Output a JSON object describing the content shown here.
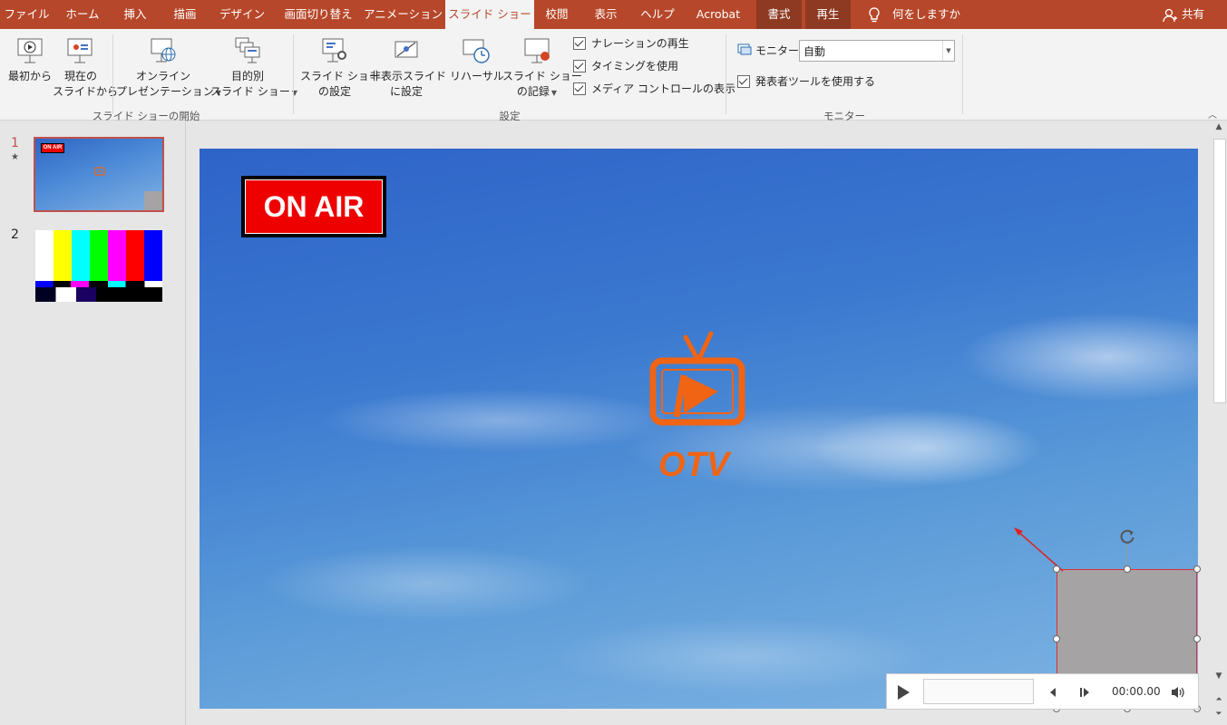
{
  "tabs": [
    "ファイル",
    "ホーム",
    "挿入",
    "描画",
    "デザイン",
    "画面切り替え",
    "アニメーション",
    "スライド ショー",
    "校閲",
    "表示",
    "ヘルプ",
    "Acrobat",
    "書式",
    "再生"
  ],
  "active_tab": "スライド ショー",
  "tell_me": "何をしますか",
  "share": "共有",
  "ribbon": {
    "start_group": "スライド ショーの開始",
    "from_beginning": "最初から",
    "from_current_1": "現在の",
    "from_current_2": "スライドから",
    "online_1": "オンライン",
    "online_2": "プレゼンテーション",
    "custom_1": "目的別",
    "custom_2": "スライド ショー",
    "setup_group": "設定",
    "setup_1": "スライド ショー",
    "setup_2": "の設定",
    "hide_1": "非表示スライド",
    "hide_2": "に設定",
    "rehearse": "リハーサル",
    "record_1": "スライド ショー",
    "record_2": "の記録",
    "chk_narration": "ナレーションの再生",
    "chk_timing": "タイミングを使用",
    "chk_media": "メディア コントロールの表示",
    "monitor_group": "モニター",
    "monitor_label": "モニター:",
    "monitor_value": "自動",
    "presenter_view": "発表者ツールを使用する"
  },
  "slides": [
    {
      "number": "1",
      "selected": true
    },
    {
      "number": "2",
      "selected": false
    }
  ],
  "slide": {
    "on_air": "ON AIR",
    "logo_text": "OTV"
  },
  "media": {
    "time": "00:00.00"
  },
  "colors": {
    "accent": "#b7472a",
    "logo": "#f06414",
    "on_air_bg": "#ee0000",
    "selection": "#e03030"
  }
}
